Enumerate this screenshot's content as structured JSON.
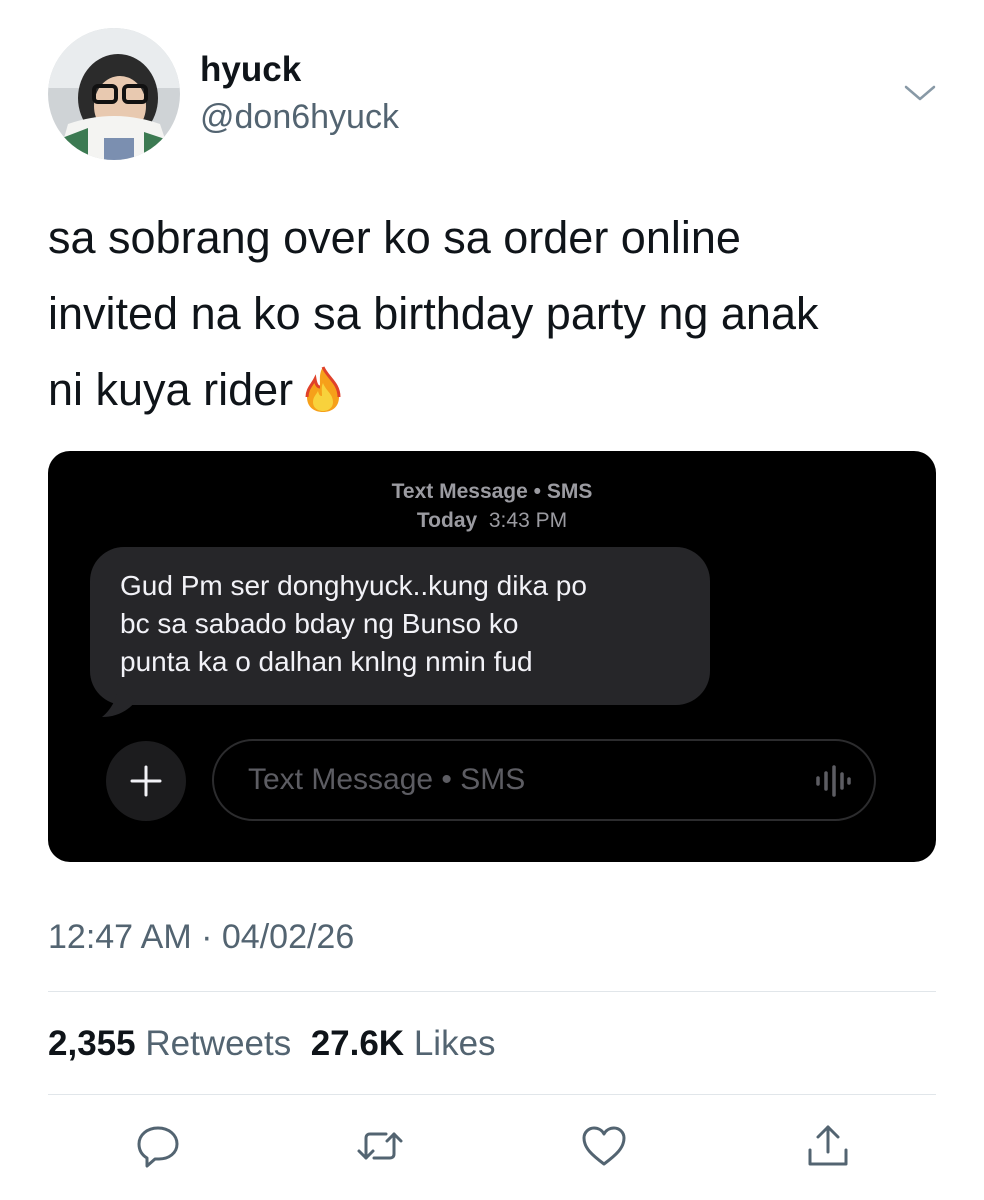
{
  "user": {
    "display_name": "hyuck",
    "handle": "@don6hyuck"
  },
  "tweet": {
    "lines": [
      "sa sobrang over ko sa order online",
      "invited na ko sa birthday party ng anak",
      "ni kuya rider"
    ],
    "emoji": "fire-emoji"
  },
  "sms": {
    "header_title": "Text Message • SMS",
    "header_day": "Today",
    "header_time": "3:43 PM",
    "message_lines": [
      "Gud Pm ser donghyuck..kung dika po",
      "bc sa sabado bday ng Bunso ko",
      "punta ka o dalhan knlng nmin fud"
    ],
    "input_placeholder": "Text Message • SMS"
  },
  "meta": {
    "time": "12:47 AM",
    "separator": "·",
    "date": "04/02/26"
  },
  "stats": {
    "retweets_count": "2,355",
    "retweets_label": "Retweets",
    "likes_count": "27.6K",
    "likes_label": "Likes"
  },
  "icons": {
    "reply": "reply-icon",
    "retweet": "retweet-icon",
    "like": "heart-icon",
    "share": "share-icon",
    "more": "chevron-down-icon"
  },
  "colors": {
    "text": "#0f1419",
    "secondary": "#536471",
    "sms_background": "#000000",
    "bubble": "#262629"
  }
}
